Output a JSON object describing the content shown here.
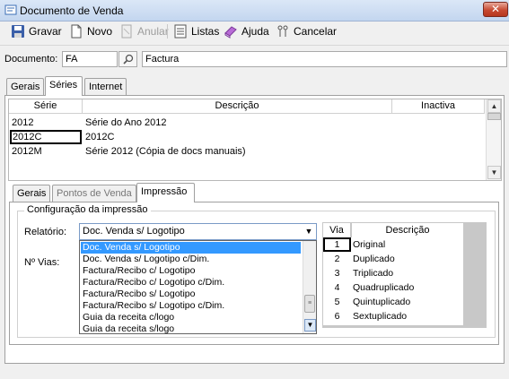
{
  "window": {
    "title": "Documento de Venda",
    "close": "✕"
  },
  "toolbar": {
    "save": "Gravar",
    "new": "Novo",
    "cancel_doc": "Anular",
    "lists": "Listas",
    "help": "Ajuda",
    "cancel": "Cancelar"
  },
  "document": {
    "label": "Documento:",
    "code": "FA",
    "description": "Factura"
  },
  "main_tabs": [
    "Gerais",
    "Séries",
    "Internet"
  ],
  "series": {
    "headers": [
      "Série",
      "Descrição",
      "Inactiva"
    ],
    "rows": [
      {
        "serie": "2012",
        "descricao": "Série do Ano 2012"
      },
      {
        "serie": "2012C",
        "descricao": "2012C"
      },
      {
        "serie": "2012M",
        "descricao": "Série 2012 (Cópia de docs manuais)"
      }
    ]
  },
  "sub_tabs": [
    "Gerais",
    "Pontos de Venda",
    "Impressão"
  ],
  "print_config": {
    "group_title": "Configuração da impressão",
    "report_label": "Relatório:",
    "report_value": "Doc. Venda s/ Logotipo",
    "vias_label": "Nº Vias:",
    "report_options": [
      "Doc. Venda s/ Logotipo",
      "Doc. Venda s/ Logotipo c/Dim.",
      "Factura/Recibo c/ Logotipo",
      "Factura/Recibo c/ Logotipo c/Dim.",
      "Factura/Recibo s/ Logotipo",
      "Factura/Recibo s/ Logotipo c/Dim.",
      "Guia da receita c/logo",
      "Guia da receita s/logo"
    ],
    "via_headers": [
      "Via",
      "Descrição"
    ],
    "vias": [
      {
        "via": "1",
        "descricao": "Original"
      },
      {
        "via": "2",
        "descricao": "Duplicado"
      },
      {
        "via": "3",
        "descricao": "Triplicado"
      },
      {
        "via": "4",
        "descricao": "Quadruplicado"
      },
      {
        "via": "5",
        "descricao": "Quintuplicado"
      },
      {
        "via": "6",
        "descricao": "Sextuplicado"
      }
    ]
  }
}
